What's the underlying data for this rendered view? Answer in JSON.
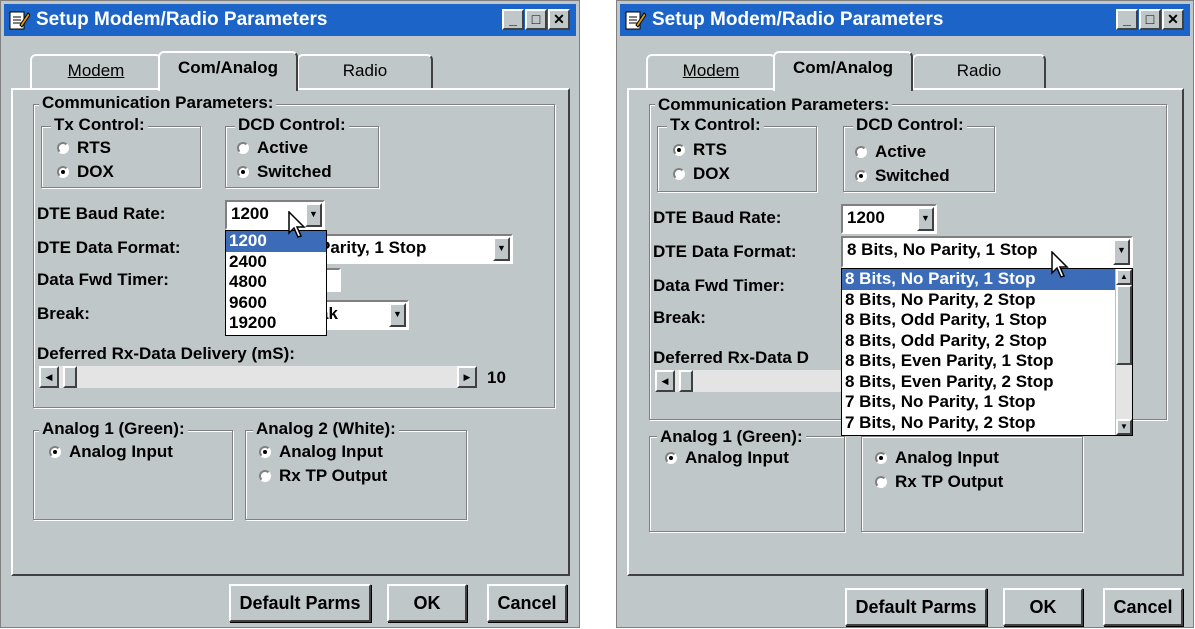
{
  "window_title": "Setup Modem/Radio Parameters",
  "tabs": [
    "Modem",
    "Com/Analog",
    "Radio"
  ],
  "comm_group_label": "Communication Parameters:",
  "tx_control": {
    "label": "Tx Control:",
    "options": [
      "RTS",
      "DOX"
    ]
  },
  "dcd_control": {
    "label": "DCD Control:",
    "options": [
      "Active",
      "Switched"
    ]
  },
  "dte_baud_label": "DTE Baud Rate:",
  "dte_format_label": "DTE Data Format:",
  "data_fwd_label": "Data Fwd Timer:",
  "break_label": "Break:",
  "deferred_label": "Deferred Rx-Data Delivery (mS):",
  "deferred_label_clipped": "Deferred Rx-Data D",
  "deferred_value": "10",
  "analog1": {
    "label": "Analog 1 (Green):",
    "options": [
      "Analog Input"
    ]
  },
  "analog2": {
    "label": "Analog 2 (White):",
    "options": [
      "Analog Input",
      "Rx TP Output"
    ]
  },
  "buttons": {
    "default": "Default Parms",
    "ok": "OK",
    "cancel": "Cancel"
  },
  "left": {
    "tx_selected": "DOX",
    "baud_value": "1200",
    "format_value_clipped": "Parity, 1 Stop",
    "break_value_clipped": "ak",
    "baud_options": [
      "1200",
      "2400",
      "4800",
      "9600",
      "19200"
    ],
    "baud_highlighted": "1200"
  },
  "right": {
    "tx_selected": "RTS",
    "baud_value": "1200",
    "format_value": "8 Bits, No Parity, 1 Stop",
    "format_options": [
      "8 Bits, No Parity, 1 Stop",
      "8 Bits, No Parity, 2 Stop",
      "8 Bits, Odd Parity, 1 Stop",
      "8 Bits, Odd Parity, 2 Stop",
      "8 Bits, Even Parity, 1 Stop",
      "8 Bits, Even Parity, 2 Stop",
      "7 Bits, No Parity, 1 Stop",
      "7 Bits, No Parity, 2 Stop"
    ],
    "format_highlighted": "8 Bits, No Parity, 1 Stop"
  },
  "colors": {
    "titlebar": "#1c64c8",
    "dialog": "#c0c7c8",
    "highlight": "#3c6cb8"
  }
}
